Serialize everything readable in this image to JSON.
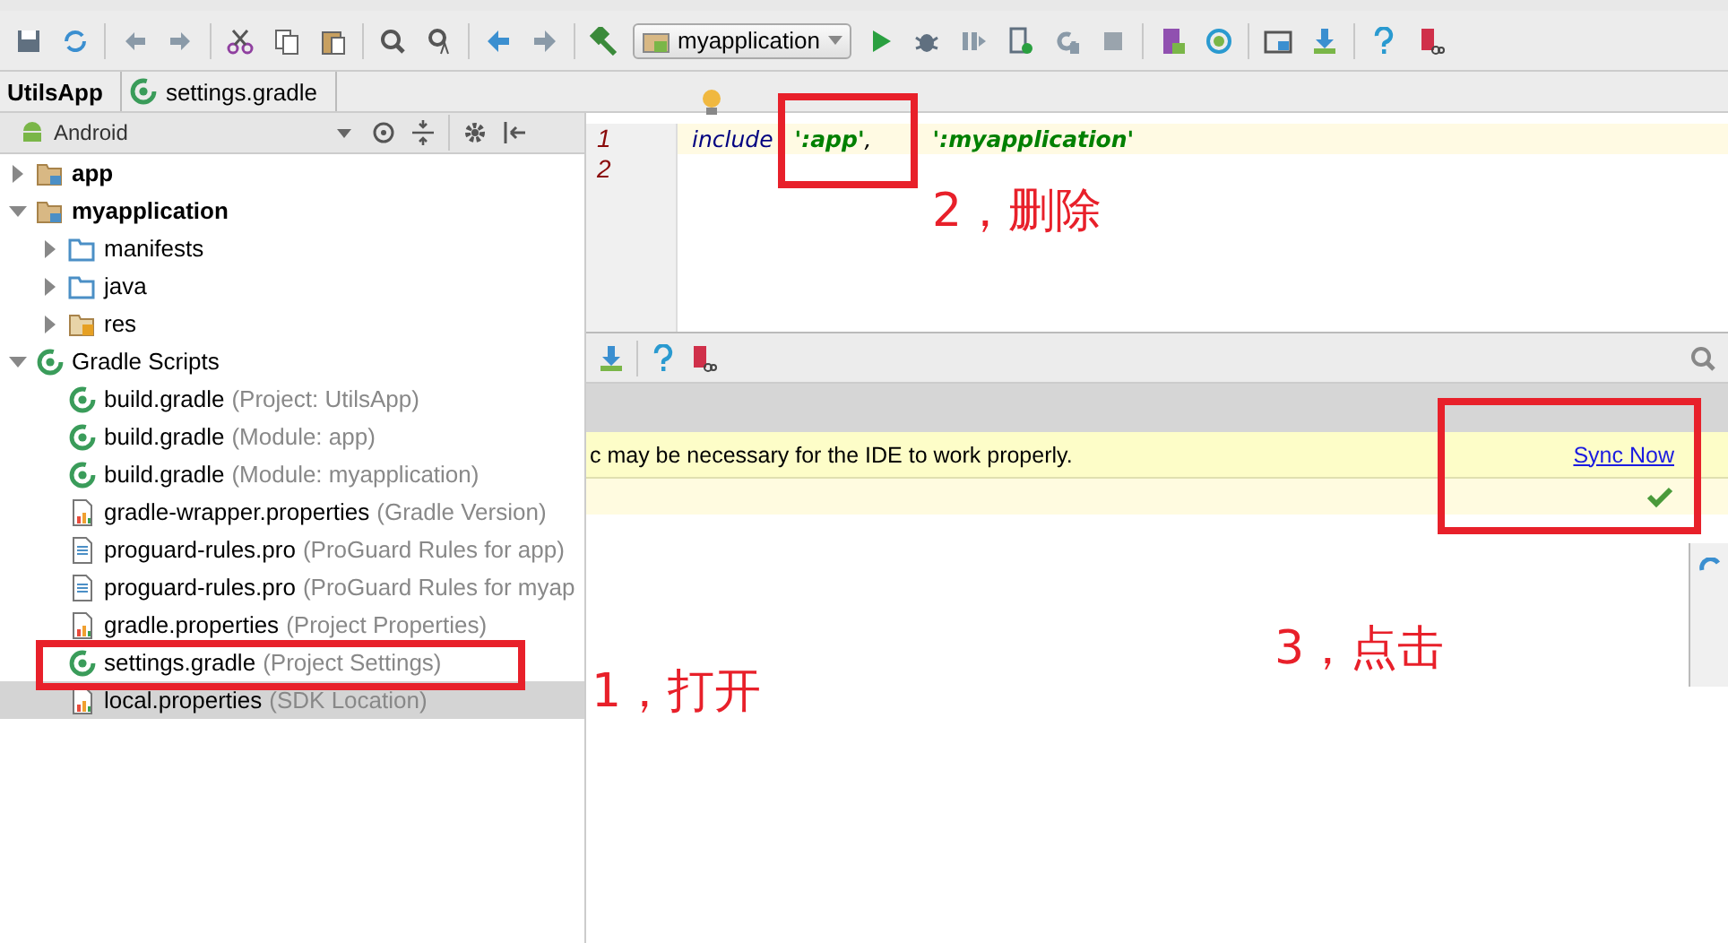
{
  "toolbar": {
    "run_config": "myapplication"
  },
  "breadcrumb": [
    {
      "label": "UtilsApp",
      "kind": "project"
    },
    {
      "label": "settings.gradle",
      "kind": "gradle"
    }
  ],
  "project_panel": {
    "view": "Android",
    "tree": [
      {
        "label": "app",
        "kind": "module",
        "bold": true,
        "expanded": false,
        "selected": false
      },
      {
        "label": "myapplication",
        "kind": "module",
        "bold": true,
        "expanded": true,
        "selected": false,
        "children": [
          {
            "label": "manifests",
            "kind": "folder",
            "bold": false,
            "expanded": false,
            "selected": false
          },
          {
            "label": "java",
            "kind": "folder",
            "bold": false,
            "expanded": false,
            "selected": false
          },
          {
            "label": "res",
            "kind": "res",
            "bold": false,
            "expanded": false,
            "selected": false
          }
        ]
      },
      {
        "label": "Gradle Scripts",
        "kind": "gradle",
        "bold": false,
        "expanded": true,
        "selected": false,
        "children": [
          {
            "label": "build.gradle",
            "detail": "(Project: UtilsApp)",
            "kind": "gradle",
            "bold": false,
            "selected": false
          },
          {
            "label": "build.gradle",
            "detail": "(Module: app)",
            "kind": "gradle",
            "bold": false,
            "selected": false
          },
          {
            "label": "build.gradle",
            "detail": "(Module: myapplication)",
            "kind": "gradle",
            "bold": false,
            "selected": false
          },
          {
            "label": "gradle-wrapper.properties",
            "detail": "(Gradle Version)",
            "kind": "props",
            "bold": false,
            "selected": false
          },
          {
            "label": "proguard-rules.pro",
            "detail": "(ProGuard Rules for app)",
            "kind": "text",
            "bold": false,
            "selected": false
          },
          {
            "label": "proguard-rules.pro",
            "detail": "(ProGuard Rules for myap",
            "kind": "text",
            "bold": false,
            "selected": false
          },
          {
            "label": "gradle.properties",
            "detail": "(Project Properties)",
            "kind": "props",
            "bold": false,
            "selected": false
          },
          {
            "label": "settings.gradle",
            "detail": "(Project Settings)",
            "kind": "gradle",
            "bold": false,
            "selected": false
          },
          {
            "label": "local.properties",
            "detail": "(SDK Location)",
            "kind": "props",
            "bold": false,
            "selected": true
          }
        ]
      }
    ]
  },
  "editor": {
    "lines": [
      {
        "number": "1",
        "current": true,
        "tokens": [
          {
            "kind": "keyword",
            "text": "include"
          },
          {
            "kind": "string",
            "text": "':app'"
          },
          {
            "kind": "plain",
            "text": ","
          },
          {
            "kind": "string",
            "text": "':myapplication'"
          }
        ]
      },
      {
        "number": "2",
        "current": false
      }
    ]
  },
  "notification": {
    "message": "c may be necessary for the IDE to work properly.",
    "action": "Sync Now"
  },
  "annotations": [
    {
      "text": "1，打开"
    },
    {
      "text": "2，删除"
    },
    {
      "text": "3，点击"
    }
  ]
}
